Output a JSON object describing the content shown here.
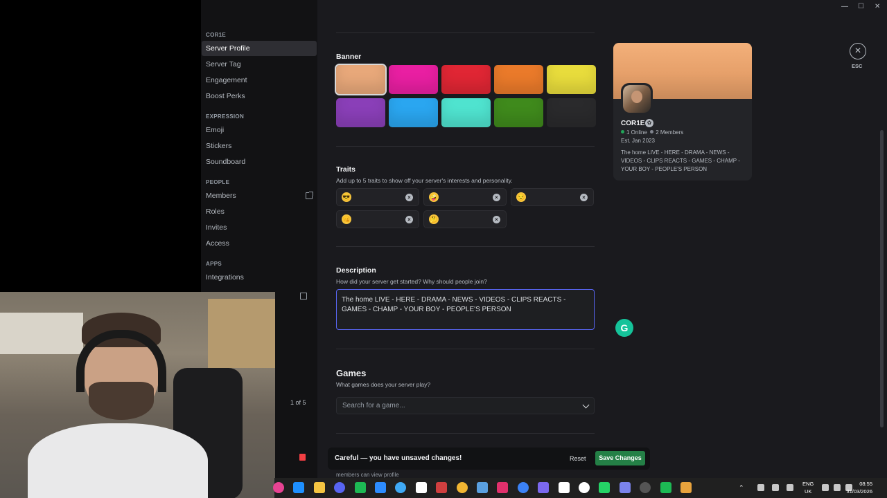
{
  "sidebar": {
    "server_name": "COR1E",
    "items_top": [
      "Server Profile",
      "Server Tag",
      "Engagement",
      "Boost Perks"
    ],
    "section_expression": "EXPRESSION",
    "items_expression": [
      "Emoji",
      "Stickers",
      "Soundboard"
    ],
    "section_people": "PEOPLE",
    "items_people": [
      "Members",
      "Roles",
      "Invites",
      "Access"
    ],
    "section_apps": "APPS",
    "items_apps": [
      "Integrations"
    ],
    "page_indicator": "1 of 5"
  },
  "banner": {
    "title": "Banner",
    "colors": [
      "#e8a87a",
      "#e91fa2",
      "#e02634",
      "#ea7a2a",
      "#e8dc3c",
      "#8a3fb8",
      "#2aa6f0",
      "#4fe3cf",
      "#3f8a1c",
      "#2a2a2c"
    ]
  },
  "traits": {
    "title": "Traits",
    "subtitle": "Add up to 5 traits to show off your server's interests and personality.",
    "items": [
      "😎",
      "🤪",
      "😒",
      "👊",
      "🤔"
    ]
  },
  "description": {
    "title": "Description",
    "subtitle": "How did your server get started? Why should people join?",
    "value": "The home LIVE - HERE - DRAMA - NEWS - VIDEOS - CLIPS REACTS - GAMES - CHAMP - YOUR BOY - PEOPLE'S PERSON"
  },
  "games": {
    "title": "Games",
    "subtitle": "What games does your server play?",
    "placeholder": "Search for a game..."
  },
  "preview_card": {
    "name": "COR1E",
    "online": "1 Online",
    "members": "2 Members",
    "established": "Est. Jan 2023",
    "description": "The home LIVE - HERE - DRAMA - NEWS - VIDEOS - CLIPS REACTS - GAMES - CHAMP - YOUR BOY - PEOPLE'S PERSON"
  },
  "close": {
    "icon": "close-icon",
    "label": "ESC"
  },
  "unsaved_bar": {
    "message": "Careful — you have unsaved changes!",
    "reset_label": "Reset",
    "save_label": "Save Changes",
    "below_text": "members can view profile"
  },
  "taskbar": {
    "lang": "ENG",
    "region": "UK",
    "time": "08:55",
    "date": "31/03/2026",
    "badge": "76"
  },
  "colors": {
    "accent": "#5865f2",
    "save_green": "#248046",
    "online_green": "#23a55a"
  }
}
